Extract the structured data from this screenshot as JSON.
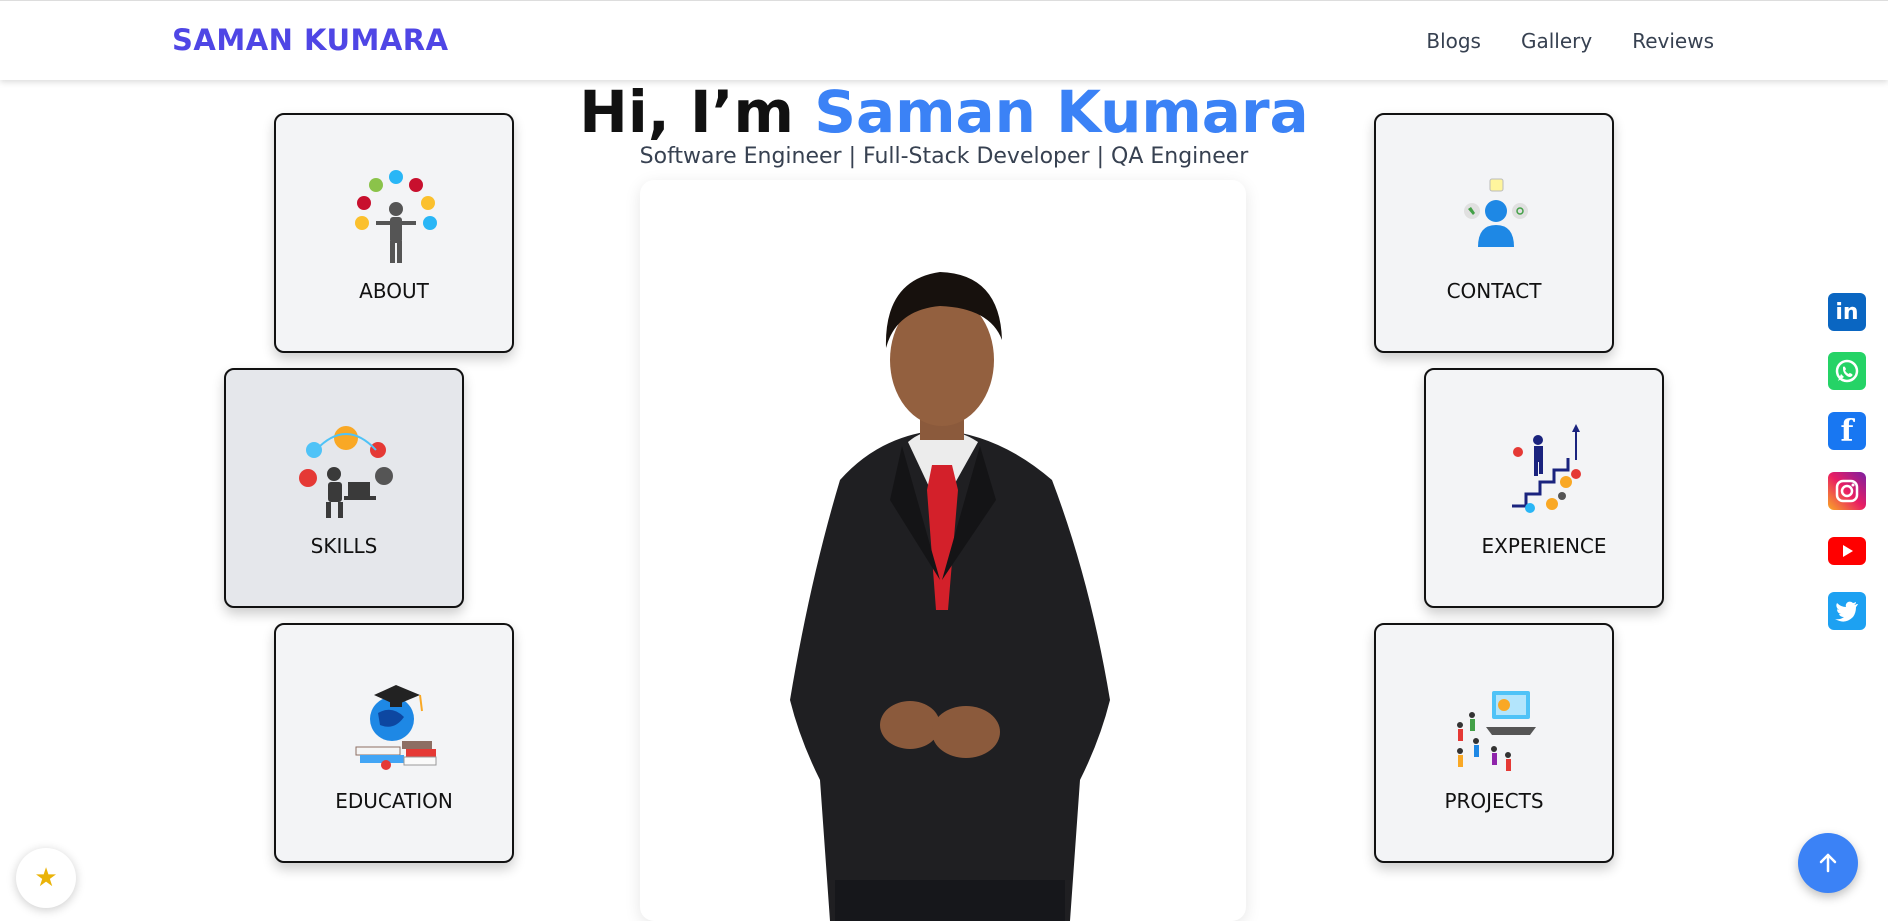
{
  "nav": {
    "brand": "SAMAN KUMARA",
    "links": [
      "Blogs",
      "Gallery",
      "Reviews"
    ]
  },
  "hero": {
    "greeting": "Hi, I’m ",
    "name": "Saman Kumara",
    "subtitle": "Software Engineer | Full-Stack Developer | QA Engineer"
  },
  "cards": {
    "about": "ABOUT",
    "skills": "SKILLS",
    "education": "EDUCATION",
    "contact": "CONTACT",
    "experience": "EXPERIENCE",
    "projects": "PROJECTS"
  },
  "social": {
    "linkedin": "in",
    "facebook": "f"
  },
  "colors": {
    "brand": "#4f46e5",
    "accent": "#3b82f6",
    "linkedin": "#0a66c2",
    "whatsapp": "#25d366",
    "facebook": "#1877f2",
    "youtube": "#ff0000",
    "twitter": "#1da1f2"
  },
  "icons": [
    "profile-photo",
    "about-illustration-icon",
    "skills-illustration-icon",
    "education-illustration-icon",
    "contact-illustration-icon",
    "experience-illustration-icon",
    "projects-illustration-icon",
    "linkedin-icon",
    "whatsapp-icon",
    "facebook-icon",
    "instagram-icon",
    "youtube-icon",
    "twitter-icon",
    "arrow-up-icon",
    "star-icon"
  ]
}
